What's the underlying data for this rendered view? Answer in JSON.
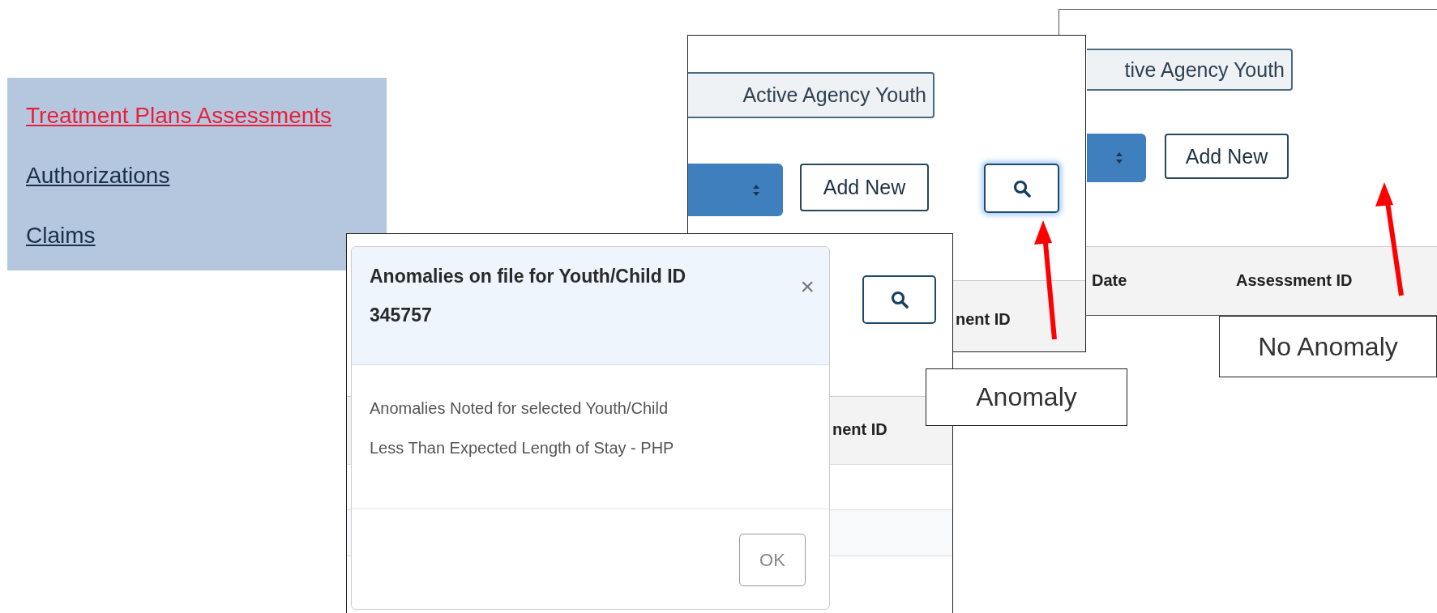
{
  "nav_panel": {
    "links": [
      {
        "label": "Treatment Plans Assessments",
        "selected": true
      },
      {
        "label": "Authorizations",
        "selected": false
      },
      {
        "label": "Claims",
        "selected": false
      }
    ]
  },
  "no_anomaly_screenshot": {
    "filter_button": "tive Agency Youth",
    "add_button": "Add New",
    "columns": [
      "Date",
      "Assessment ID"
    ]
  },
  "anomaly_screenshot": {
    "filter_button": "Active Agency Youth",
    "add_button": "Add New",
    "search_focused": true,
    "column_header": "nent ID"
  },
  "modal_screenshot": {
    "column_header": "nent ID",
    "modal": {
      "title": "Anomalies on file for Youth/Child ID 345757",
      "close": "×",
      "body_lines": [
        "Anomalies Noted for selected Youth/Child",
        "Less Than Expected Length of Stay - PHP"
      ],
      "ok_button": "OK"
    }
  },
  "captions": [
    {
      "kind": "anomaly",
      "text": "Anomaly"
    },
    {
      "kind": "no-anomaly",
      "text": "No Anomaly"
    }
  ]
}
